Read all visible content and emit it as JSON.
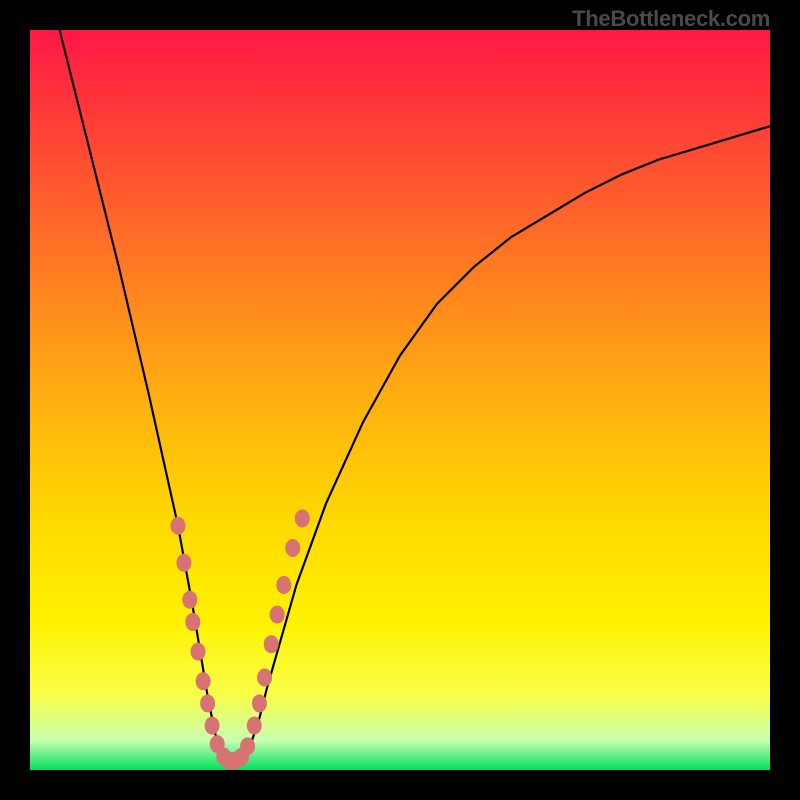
{
  "watermark": "TheBottleneck.com",
  "colors": {
    "gradient_stops": [
      {
        "offset": "0%",
        "color": "#ff1846"
      },
      {
        "offset": "14%",
        "color": "#ff4236"
      },
      {
        "offset": "32%",
        "color": "#ff7a22"
      },
      {
        "offset": "50%",
        "color": "#ffb010"
      },
      {
        "offset": "66%",
        "color": "#ffd800"
      },
      {
        "offset": "80%",
        "color": "#fff200"
      },
      {
        "offset": "90%",
        "color": "#f8ff4a"
      },
      {
        "offset": "96%",
        "color": "#c8ffb0"
      },
      {
        "offset": "100%",
        "color": "#00e060"
      }
    ],
    "dot_fill": "#d97272",
    "curve_stroke": "#000000",
    "frame": "#000000"
  },
  "chart_data": {
    "type": "line",
    "title": "",
    "xlabel": "",
    "ylabel": "",
    "xlim": [
      0,
      100
    ],
    "ylim": [
      0,
      100
    ],
    "grid": false,
    "note": "Values are read from the plot: x in 0-100 left→right, y is bottleneck % (0 at bottom, 100 at top). Curve is a V with minimum near x≈27.",
    "series": [
      {
        "name": "bottleneck-curve",
        "x": [
          0,
          4,
          8,
          12,
          16,
          18,
          20,
          22,
          23,
          24,
          25,
          26,
          27,
          28,
          29,
          30,
          31,
          32,
          34,
          36,
          40,
          45,
          50,
          55,
          60,
          65,
          70,
          75,
          80,
          85,
          90,
          95,
          100
        ],
        "y": [
          115,
          100,
          84,
          68,
          51,
          42,
          33,
          22,
          16,
          10,
          5,
          2,
          1,
          1,
          2,
          4,
          7,
          11,
          18,
          25,
          36,
          47,
          56,
          63,
          68,
          72,
          75,
          78,
          80.5,
          82.5,
          84,
          85.5,
          87
        ]
      }
    ],
    "points": [
      {
        "x": 20.0,
        "y": 33
      },
      {
        "x": 20.8,
        "y": 28
      },
      {
        "x": 21.6,
        "y": 23
      },
      {
        "x": 22.0,
        "y": 20
      },
      {
        "x": 22.7,
        "y": 16
      },
      {
        "x": 23.4,
        "y": 12
      },
      {
        "x": 24.0,
        "y": 9
      },
      {
        "x": 24.6,
        "y": 6
      },
      {
        "x": 25.3,
        "y": 3.5
      },
      {
        "x": 26.2,
        "y": 1.8
      },
      {
        "x": 27.0,
        "y": 1.2
      },
      {
        "x": 27.8,
        "y": 1.3
      },
      {
        "x": 28.6,
        "y": 1.8
      },
      {
        "x": 29.4,
        "y": 3.2
      },
      {
        "x": 30.3,
        "y": 6
      },
      {
        "x": 31.0,
        "y": 9
      },
      {
        "x": 31.7,
        "y": 12.5
      },
      {
        "x": 32.6,
        "y": 17
      },
      {
        "x": 33.4,
        "y": 21
      },
      {
        "x": 34.3,
        "y": 25
      },
      {
        "x": 35.5,
        "y": 30
      },
      {
        "x": 36.8,
        "y": 34
      }
    ]
  }
}
